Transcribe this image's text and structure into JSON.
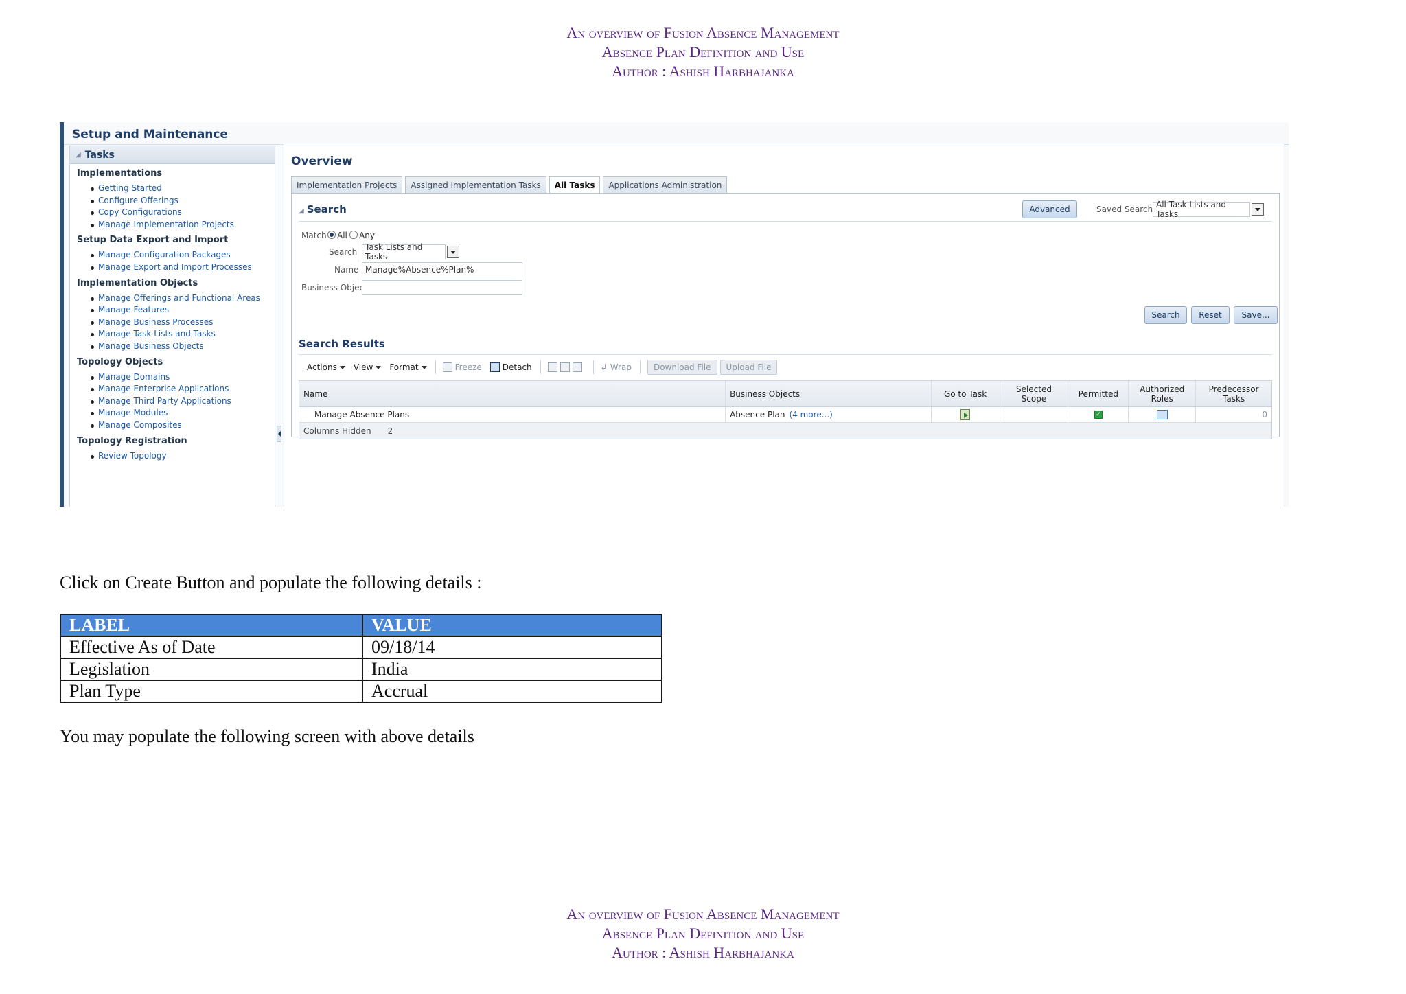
{
  "header": {
    "line1": "An overview of Fusion Absence Management",
    "line2": "Absence Plan Definition and Use",
    "line3": "Author : Ashish Harbhajanka"
  },
  "screenshot": {
    "title": "Setup and Maintenance",
    "tasks_panel": {
      "title": "Tasks",
      "groups": [
        {
          "title": "Implementations",
          "items": [
            "Getting Started",
            "Configure Offerings",
            "Copy Configurations",
            "Manage Implementation Projects"
          ]
        },
        {
          "title": "Setup Data Export and Import",
          "items": [
            "Manage Configuration Packages",
            "Manage Export and Import Processes"
          ]
        },
        {
          "title": "Implementation Objects",
          "items": [
            "Manage Offerings and Functional Areas",
            "Manage Features",
            "Manage Business Processes",
            "Manage Task Lists and Tasks",
            "Manage Business Objects"
          ]
        },
        {
          "title": "Topology Objects",
          "items": [
            "Manage Domains",
            "Manage Enterprise Applications",
            "Manage Third Party Applications",
            "Manage Modules",
            "Manage Composites"
          ]
        },
        {
          "title": "Topology Registration",
          "items": [
            "Review Topology"
          ]
        }
      ]
    },
    "overview": {
      "title": "Overview",
      "tabs": [
        "Implementation Projects",
        "Assigned Implementation Tasks",
        "All Tasks",
        "Applications Administration"
      ],
      "active_tab": "All Tasks",
      "search": {
        "title": "Search",
        "advanced_label": "Advanced",
        "saved_search_label": "Saved Search",
        "saved_search_value": "All Task Lists and Tasks",
        "match_label": "Match",
        "match_all": "All",
        "match_any": "Any",
        "search_label": "Search",
        "search_value": "Task Lists and Tasks",
        "name_label": "Name",
        "name_value": "Manage%Absence%Plan%",
        "business_object_label": "Business Object",
        "business_object_value": "",
        "search_button": "Search",
        "reset_button": "Reset",
        "save_button": "Save..."
      },
      "results": {
        "title": "Search Results",
        "toolbar": {
          "actions": "Actions",
          "view": "View",
          "format": "Format",
          "freeze": "Freeze",
          "detach": "Detach",
          "wrap": "Wrap",
          "download": "Download File",
          "upload": "Upload File"
        },
        "columns": [
          "Name",
          "Business Objects",
          "Go to Task",
          "Selected Scope",
          "Permitted",
          "Authorized Roles",
          "Predecessor Tasks"
        ],
        "rows": [
          {
            "name": "Manage Absence Plans",
            "business_objects": "Absence Plan",
            "more": "(4 more...)",
            "predecessor": "0"
          }
        ],
        "columns_hidden_label": "Columns Hidden",
        "columns_hidden_value": "2"
      }
    }
  },
  "body": {
    "instruction": "Click on Create Button and populate the following details :",
    "table": {
      "headers": [
        "LABEL",
        "VALUE"
      ],
      "rows": [
        [
          "Effective As of Date",
          "09/18/14"
        ],
        [
          "Legislation",
          "India"
        ],
        [
          "Plan Type",
          "Accrual"
        ]
      ]
    },
    "followup": "You may populate the following screen with above details"
  }
}
